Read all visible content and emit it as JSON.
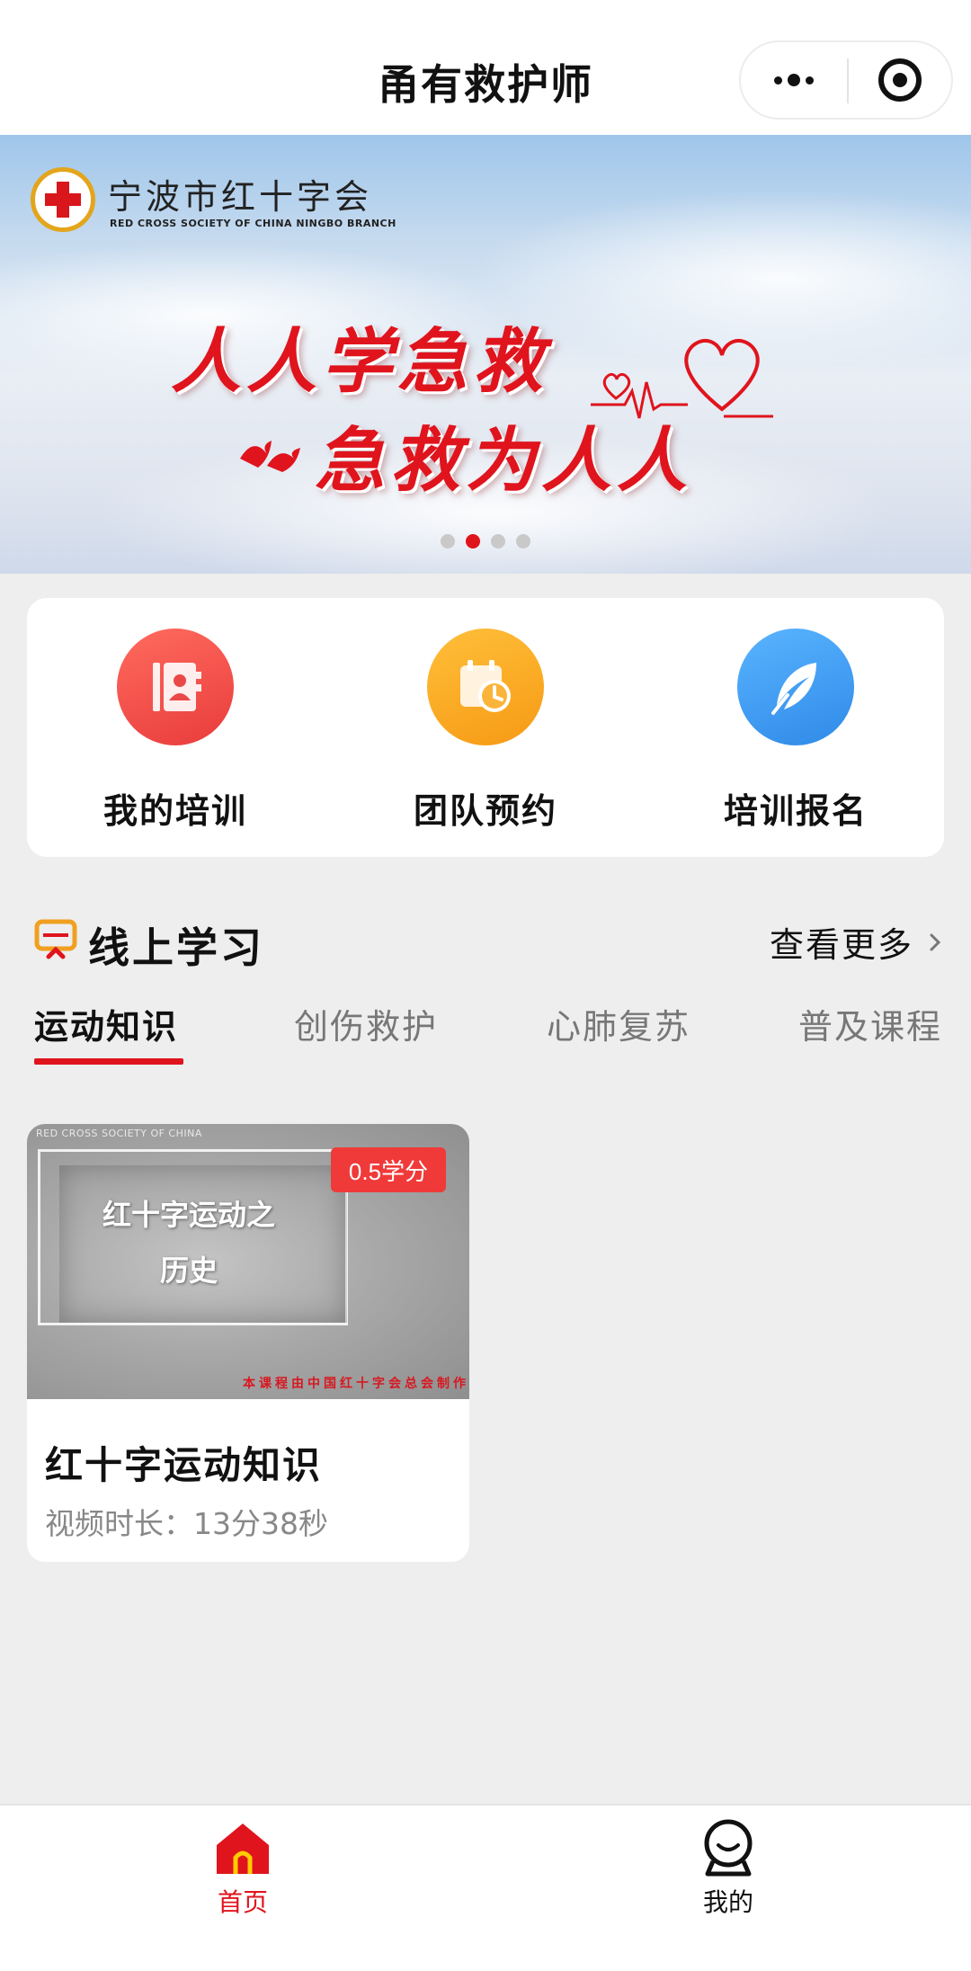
{
  "header": {
    "title": "甬有救护师",
    "more_icon": "more-dots-icon",
    "close_icon": "target-circle-icon"
  },
  "banner": {
    "org_name": "宁波市红十字会",
    "org_name_en": "RED CROSS SOCIETY OF CHINA NINGBO BRANCH",
    "slogan_line1": "人人学急救",
    "slogan_line2": "急救为人人",
    "slide_count": 4,
    "active_slide": 2
  },
  "quick_menu": [
    {
      "label": "我的培训",
      "icon": "training-book-icon",
      "color": "#f24b4b"
    },
    {
      "label": "团队预约",
      "icon": "calendar-clock-icon",
      "color": "#f9a11b"
    },
    {
      "label": "培训报名",
      "icon": "feather-pen-icon",
      "color": "#3a9af0"
    }
  ],
  "online_learning": {
    "title": "线上学习",
    "see_more": "查看更多",
    "tabs": [
      {
        "label": "运动知识",
        "active": true
      },
      {
        "label": "创伤救护",
        "active": false
      },
      {
        "label": "心肺复苏",
        "active": false
      },
      {
        "label": "普及课程",
        "active": false
      }
    ],
    "courses": [
      {
        "thumb_top_text": "RED CROSS SOCIETY OF CHINA",
        "thumb_title_line1": "红十字运动之",
        "thumb_title_line2": "历史",
        "thumb_footer": "本课程由中国红十字会总会制作",
        "credit": "0.5学分",
        "title": "红十字运动知识",
        "duration": "视频时长：13分38秒"
      }
    ]
  },
  "tabbar": [
    {
      "label": "首页",
      "icon": "home-icon",
      "active": true
    },
    {
      "label": "我的",
      "icon": "profile-icon",
      "active": false
    }
  ],
  "colors": {
    "accent_red": "#e0141d",
    "background": "#eeeeee"
  }
}
